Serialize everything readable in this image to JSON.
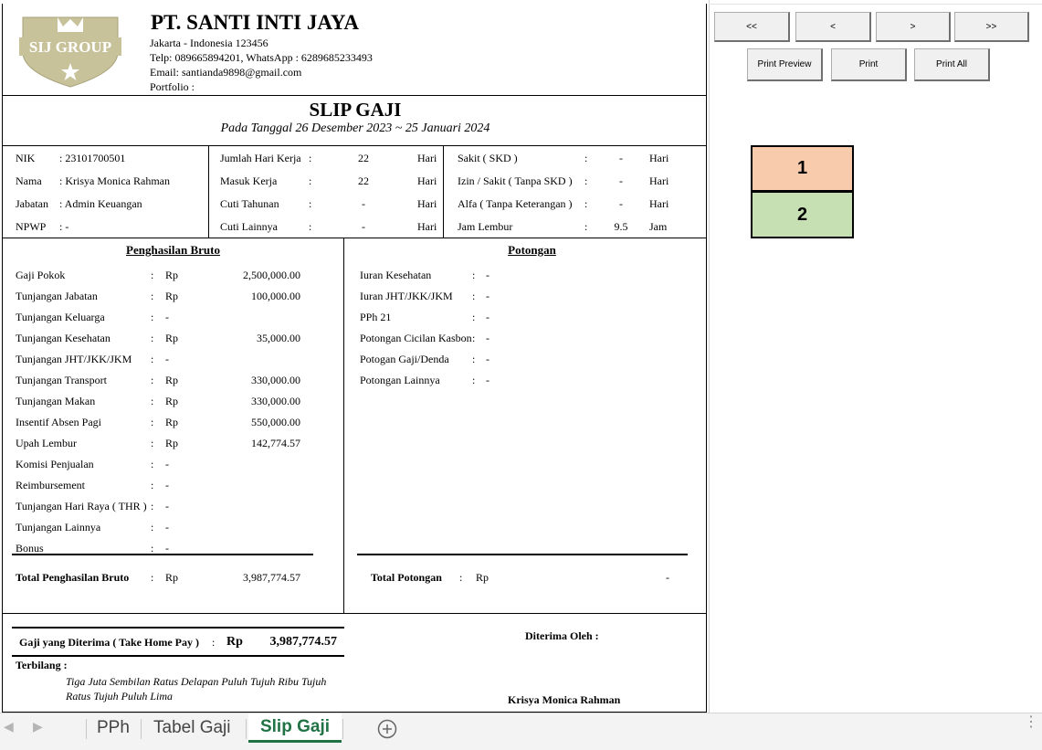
{
  "company": {
    "name": "PT. SANTI INTI JAYA",
    "address": "Jakarta - Indonesia 123456",
    "phone": "Telp: 089665894201, WhatsApp : 6289685233493",
    "email": "Email: santianda9898@gmail.com",
    "portfolio": "Portfolio :",
    "logo_text": "SIJ GROUP"
  },
  "slip": {
    "title": "SLIP GAJI",
    "period": "Pada Tanggal 26 Desember 2023 ~ 25 Januari 2024"
  },
  "employee": [
    {
      "label": "NIK",
      "value": ": 23101700501"
    },
    {
      "label": "Nama",
      "value": ": Krisya Monica Rahman"
    },
    {
      "label": "Jabatan",
      "value": ": Admin Keuangan"
    },
    {
      "label": "NPWP",
      "value": ": -"
    }
  ],
  "attendance": [
    {
      "label": "Jumlah Hari Kerja",
      "value": "22",
      "unit": "Hari"
    },
    {
      "label": "Masuk Kerja",
      "value": "22",
      "unit": "Hari"
    },
    {
      "label": "Cuti Tahunan",
      "value": "-",
      "unit": "Hari"
    },
    {
      "label": "Cuti Lainnya",
      "value": "-",
      "unit": "Hari"
    }
  ],
  "absence": [
    {
      "label": "Sakit ( SKD )",
      "value": "-",
      "unit": "Hari"
    },
    {
      "label": "Izin / Sakit ( Tanpa SKD )",
      "value": "-",
      "unit": "Hari"
    },
    {
      "label": "Alfa ( Tanpa Keterangan )",
      "value": "-",
      "unit": "Hari"
    },
    {
      "label": "Jam Lembur",
      "value": "9.5",
      "unit": "Jam"
    }
  ],
  "colon": ":",
  "income": {
    "header": "Penghasilan Bruto",
    "items": [
      {
        "label": "Gaji Pokok",
        "cur": "Rp",
        "amount": "2,500,000.00"
      },
      {
        "label": "Tunjangan Jabatan",
        "cur": "Rp",
        "amount": "100,000.00"
      },
      {
        "label": "Tunjangan Keluarga",
        "cur": "-",
        "amount": ""
      },
      {
        "label": "Tunjangan Kesehatan",
        "cur": "Rp",
        "amount": "35,000.00"
      },
      {
        "label": "Tunjangan JHT/JKK/JKM",
        "cur": "-",
        "amount": ""
      },
      {
        "label": "Tunjangan Transport",
        "cur": "Rp",
        "amount": "330,000.00"
      },
      {
        "label": "Tunjangan Makan",
        "cur": "Rp",
        "amount": "330,000.00"
      },
      {
        "label": "Insentif  Absen Pagi",
        "cur": "Rp",
        "amount": "550,000.00"
      },
      {
        "label": "Upah Lembur",
        "cur": "Rp",
        "amount": "142,774.57"
      },
      {
        "label": "Komisi Penjualan",
        "cur": "-",
        "amount": ""
      },
      {
        "label": "Reimbursement",
        "cur": "-",
        "amount": ""
      },
      {
        "label": "Tunjangan Hari Raya ( THR )",
        "cur": "-",
        "amount": ""
      },
      {
        "label": "Tunjangan Lainnya",
        "cur": "-",
        "amount": ""
      },
      {
        "label": "Bonus",
        "cur": "-",
        "amount": ""
      }
    ],
    "total_label": "Total Penghasilan Bruto",
    "total_cur": "Rp",
    "total_amount": "3,987,774.57"
  },
  "deduction": {
    "header": "Potongan",
    "items": [
      {
        "label": "Iuran Kesehatan",
        "value": "-"
      },
      {
        "label": "Iuran JHT/JKK/JKM",
        "value": "-"
      },
      {
        "label": "PPh 21",
        "value": "-"
      },
      {
        "label": "Potongan Cicilan Kasbon",
        "value": "-"
      },
      {
        "label": "Potogan Gaji/Denda",
        "value": "-"
      },
      {
        "label": "Potongan Lainnya",
        "value": "-"
      }
    ],
    "total_label": "Total Potongan",
    "total_cur": "Rp",
    "total_amount": "-"
  },
  "take_home": {
    "label": "Gaji yang Diterima ( Take Home Pay )",
    "cur": "Rp",
    "amount": "3,987,774.57"
  },
  "terbilang": {
    "label": "Terbilang :",
    "line1": "Tiga Juta Sembilan Ratus Delapan Puluh Tujuh Ribu Tujuh",
    "line2": "Ratus Tujuh Puluh Lima"
  },
  "received": {
    "label": "Diterima Oleh :",
    "name": "Krisya Monica Rahman"
  },
  "buttons": {
    "first": "<<",
    "prev": "<",
    "next": ">",
    "last": ">>",
    "print_preview": "Print Preview",
    "print": "Print",
    "print_all": "Print All"
  },
  "boxes": {
    "one": "1",
    "two": "2"
  },
  "sheet_tabs": {
    "tabs": [
      "PPh",
      "Tabel Gaji",
      "Slip Gaji"
    ],
    "active": "Slip Gaji"
  }
}
